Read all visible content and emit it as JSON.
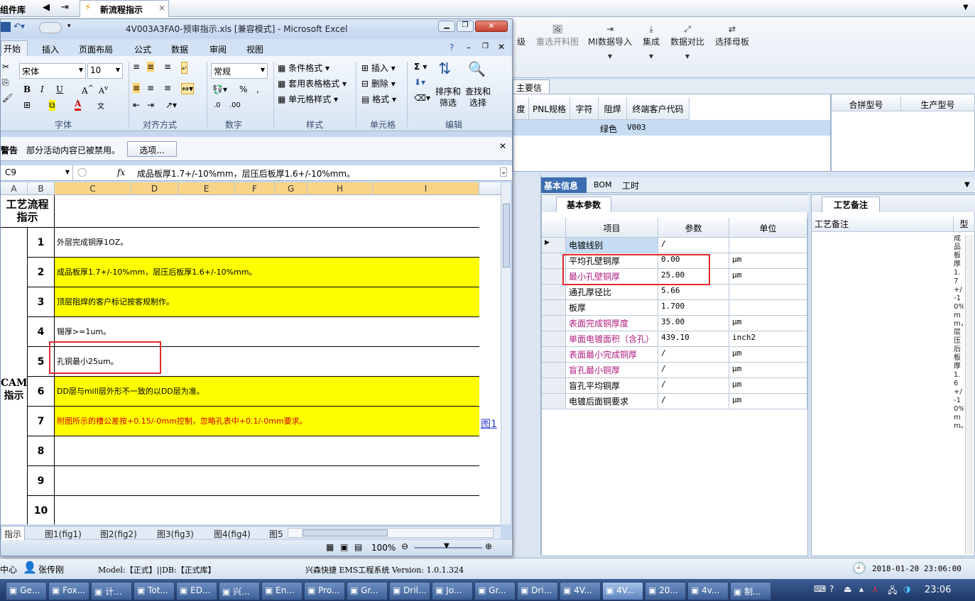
{
  "bg_app": {
    "tabs": {
      "lib": "组件库",
      "active_tab": "新流程指示",
      "close": "×"
    },
    "ribbon_buttons": [
      {
        "label": "级"
      },
      {
        "label": "重选开料图"
      },
      {
        "label": "MI数据导入"
      },
      {
        "label": "集成"
      },
      {
        "label": "数据对比"
      },
      {
        "label": "选择母板"
      }
    ],
    "info_tab": "主要信息",
    "top_table": {
      "headers": [
        "度",
        "PNL规格",
        "字符",
        "阻焊",
        "终端客户代码"
      ],
      "row": [
        "",
        "",
        "",
        "绿色",
        "V003"
      ]
    },
    "merge_table": {
      "headers": [
        "合拼型号",
        "生产型号"
      ]
    },
    "detail_tabs": [
      "基本信息",
      "BOM",
      "工时"
    ],
    "basic_params_tab": "基本参数",
    "craft_notes_tab": "工艺备注",
    "params_headers": [
      "项目",
      "参数",
      "单位"
    ],
    "params": [
      {
        "item": "电镀线别",
        "value": "/",
        "unit": ""
      },
      {
        "item": "平均孔壁铜厚",
        "value": "0.00",
        "unit": "μm"
      },
      {
        "item": "最小孔壁铜厚",
        "value": "25.00",
        "unit": "μm"
      },
      {
        "item": "通孔厚径比",
        "value": "5.66",
        "unit": ""
      },
      {
        "item": "板厚",
        "value": "1.700",
        "unit": ""
      },
      {
        "item": "表面完成铜厚度",
        "value": "35.00",
        "unit": "μm"
      },
      {
        "item": "单面电镀面积（含孔）",
        "value": "439.10",
        "unit": "inch2"
      },
      {
        "item": "表面最小完成铜厚",
        "value": "/",
        "unit": "μm"
      },
      {
        "item": "盲孔最小铜厚",
        "value": "/",
        "unit": "μm"
      },
      {
        "item": "盲孔平均铜厚",
        "value": "/",
        "unit": "μm"
      },
      {
        "item": "电镀后面铜要求",
        "value": "/",
        "unit": "μm"
      }
    ],
    "notes_headers": [
      "工艺备注",
      "型"
    ],
    "notes_vertical_text": "成品板厚1.7+/-10%mm，层压后板厚1.6+/-10%mm。",
    "status": {
      "left": "中心",
      "user": "张传刚",
      "model": "Model:【正式】||DB:【正式库】",
      "system": "兴森快捷 EMS工程系统 Version: 1.0.1.324",
      "datetime": "2018-01-20 23:06:00"
    }
  },
  "excel": {
    "title": "4V003A3FA0-预审指示.xls  [兼容模式] - Microsoft Excel",
    "menu_tabs": [
      "开始",
      "插入",
      "页面布局",
      "公式",
      "数据",
      "审阅",
      "视图"
    ],
    "font_name": "宋体",
    "font_size": "10",
    "number_format": "常规",
    "group_labels": [
      "字体",
      "对齐方式",
      "数字",
      "样式",
      "单元格",
      "编辑"
    ],
    "styles_items": [
      "条件格式",
      "套用表格格式",
      "单元格样式"
    ],
    "cells_items": [
      "插入",
      "删除",
      "格式"
    ],
    "edit_items": [
      "排序和\n筛选",
      "查找和\n选择"
    ],
    "security_warning": "警告",
    "security_text": "部分活动内容已被禁用。",
    "options_button": "选项...",
    "name_box": "C9",
    "fx": "fx",
    "formula": "成品板厚1.7+/-10%mm，层压后板厚1.6+/-10%mm。",
    "columns": [
      "A",
      "B",
      "C",
      "D",
      "E",
      "F",
      "G",
      "H",
      "I"
    ],
    "header_cell": "工艺流程\n指示",
    "cam_label": "CAM\n指示",
    "rows": [
      {
        "num": "1",
        "text": "外层完成铜厚1OZ。",
        "fill": "white",
        "color": "#000"
      },
      {
        "num": "2",
        "text": "成品板厚1.7+/-10%mm，层压后板厚1.6+/-10%mm。",
        "fill": "yellow",
        "color": "#000"
      },
      {
        "num": "3",
        "text": "顶层阻焊的客户标记按客规制作。",
        "fill": "yellow",
        "color": "#000"
      },
      {
        "num": "4",
        "text": "锡厚>=1um。",
        "fill": "white",
        "color": "#000"
      },
      {
        "num": "5",
        "text": "孔铜最小25um。",
        "fill": "white",
        "color": "#000"
      },
      {
        "num": "6",
        "text": "DD层与mill层外形不一致的以DD层为准。",
        "fill": "yellow",
        "color": "#000"
      },
      {
        "num": "7",
        "text": "附图所示的槽公差按+0.15/-0mm控制，忽略孔表中+0.1/-0mm要求。",
        "fill": "yellow",
        "color": "#d00000"
      },
      {
        "num": "8",
        "text": "",
        "fill": "white",
        "color": "#000"
      },
      {
        "num": "9",
        "text": "",
        "fill": "white",
        "color": "#000"
      },
      {
        "num": "10",
        "text": "",
        "fill": "white",
        "color": "#000"
      }
    ],
    "link_text": "图1",
    "sheet_tabs": [
      "指示",
      "图1(fig1)",
      "图2(fig2)",
      "图3(fig3)",
      "图4(fig4)",
      "图5"
    ],
    "zoom": "100%"
  },
  "taskbar": {
    "items": [
      "Ge...",
      "Fox...",
      "计...",
      "Tot...",
      "ED...",
      "兴...",
      "En...",
      "Pro...",
      "Gr...",
      "Dril...",
      "Jo...",
      "Gr...",
      "Dri...",
      "4V...",
      "4V...",
      "20...",
      "4v...",
      "制..."
    ],
    "clock": "23:06"
  }
}
